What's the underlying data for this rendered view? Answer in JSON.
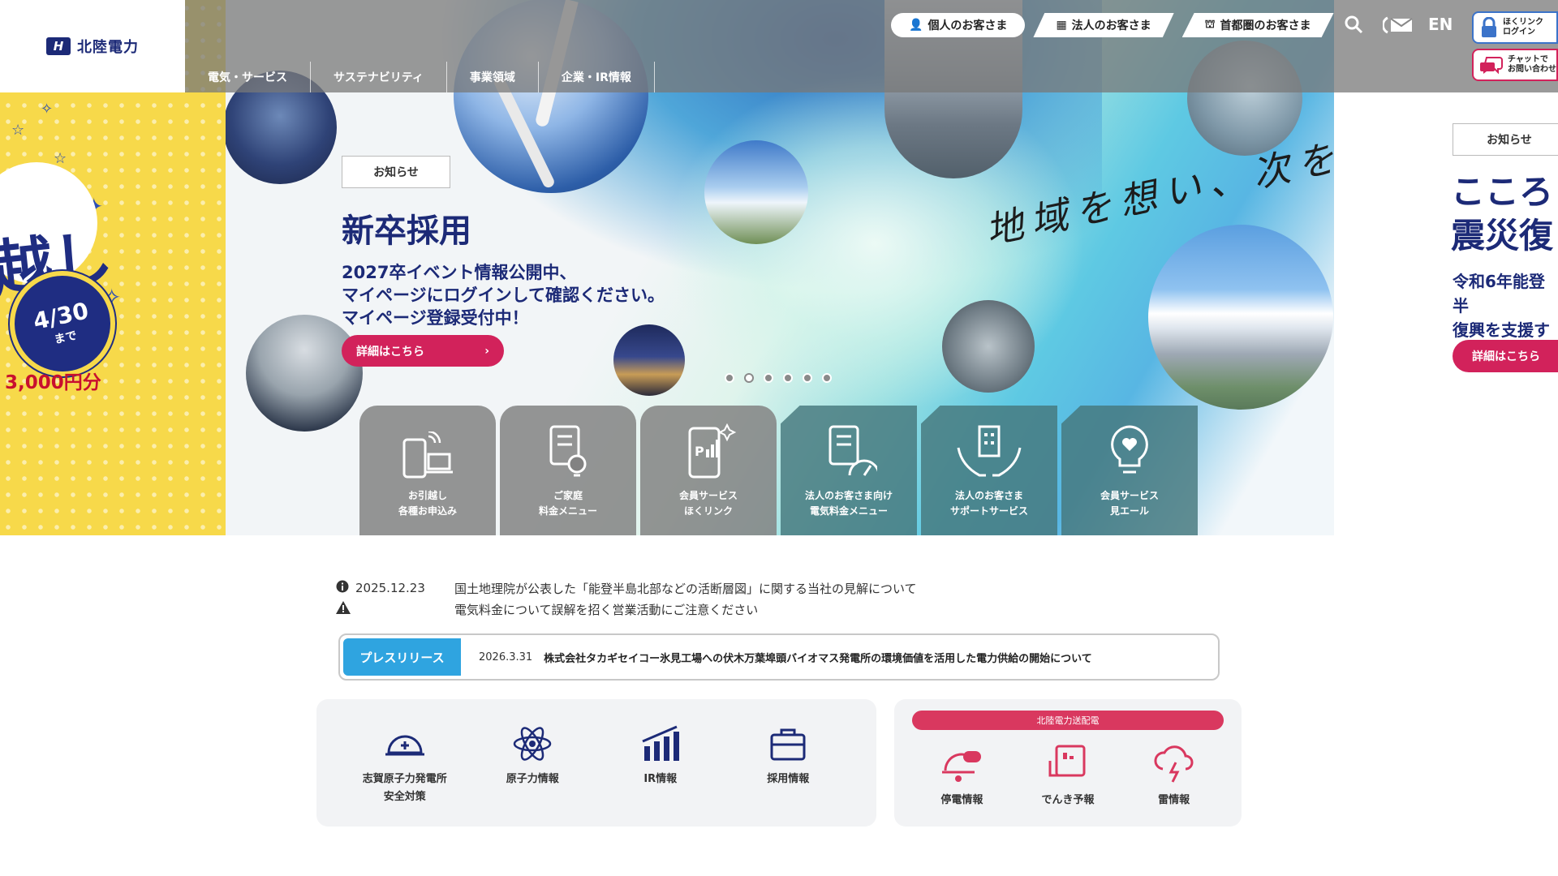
{
  "header": {
    "logo_text": "北陸電力",
    "nav": [
      "電気・サービス",
      "サステナビリティ",
      "事業領域",
      "企業・IR情報"
    ],
    "segments": [
      "個人のお客さま",
      "法人のお客さま",
      "首都圏のお客さま"
    ],
    "lang": "EN",
    "login_label": "ほくリンク\nログイン",
    "chat_label": "チャットで\nお問い合わせ"
  },
  "left_slide": {
    "big_text": "越し",
    "badge_date": "4/30",
    "badge_suffix": "まで",
    "amount": "3,000円分"
  },
  "slide": {
    "tag": "お知らせ",
    "title": "新卒採用",
    "body": "2027卒イベント情報公開中、\nマイページにログインして確認ください。\nマイページ登録受付中！",
    "button": "詳細はこちら",
    "catch_line1": "地域を想い、次を創る",
    "dots_count": 6,
    "active_dot": 1
  },
  "tiles": [
    {
      "label": "お引越し\n各種お申込み",
      "icon": "phone-laptop-icon"
    },
    {
      "label": "ご家庭\n料金メニュー",
      "icon": "document-bulb-icon"
    },
    {
      "label": "会員サービス\nほくリンク",
      "icon": "phone-chart-icon"
    },
    {
      "label": "法人のお客さま向け\n電気料金メニュー",
      "icon": "document-gauge-icon"
    },
    {
      "label": "法人のお客さま\nサポートサービス",
      "icon": "hands-building-icon"
    },
    {
      "label": "会員サービス\n見エール",
      "icon": "bulb-heart-icon"
    }
  ],
  "right_slide": {
    "tag": "お知らせ",
    "title": "こころ\n震災復",
    "sub": "令和6年能登半\n復興を支援す",
    "button": "詳細はこちら"
  },
  "news": [
    {
      "icon": "info-icon",
      "date": "2025.12.23",
      "text": "国土地理院が公表した「能登半島北部などの活断層図」に関する当社の見解について"
    },
    {
      "icon": "warning-icon",
      "date": "",
      "text": "電気料金について誤解を招く営業活動にご注意ください"
    }
  ],
  "press": {
    "label": "プレスリリース",
    "date": "2026.3.31",
    "text": "株式会社タカギセイコー氷見工場への伏木万葉埠頭バイオマス発電所の環境価値を活用した電力供給の開始について"
  },
  "links": [
    {
      "label": "志賀原子力発電所\n安全対策",
      "icon": "helmet-icon"
    },
    {
      "label": "原子力情報",
      "icon": "atom-icon"
    },
    {
      "label": "IR情報",
      "icon": "chart-up-icon"
    },
    {
      "label": "採用情報",
      "icon": "briefcase-icon"
    }
  ],
  "grid": {
    "header": "北陸電力送配電",
    "items": [
      {
        "label": "停電情報",
        "icon": "outage-icon"
      },
      {
        "label": "でんき予報",
        "icon": "forecast-icon"
      },
      {
        "label": "雷情報",
        "icon": "thunder-icon"
      }
    ]
  },
  "colors": {
    "navy": "#1c2a77",
    "accent_pink": "#d2225b",
    "press_blue": "#2fa4e0"
  }
}
